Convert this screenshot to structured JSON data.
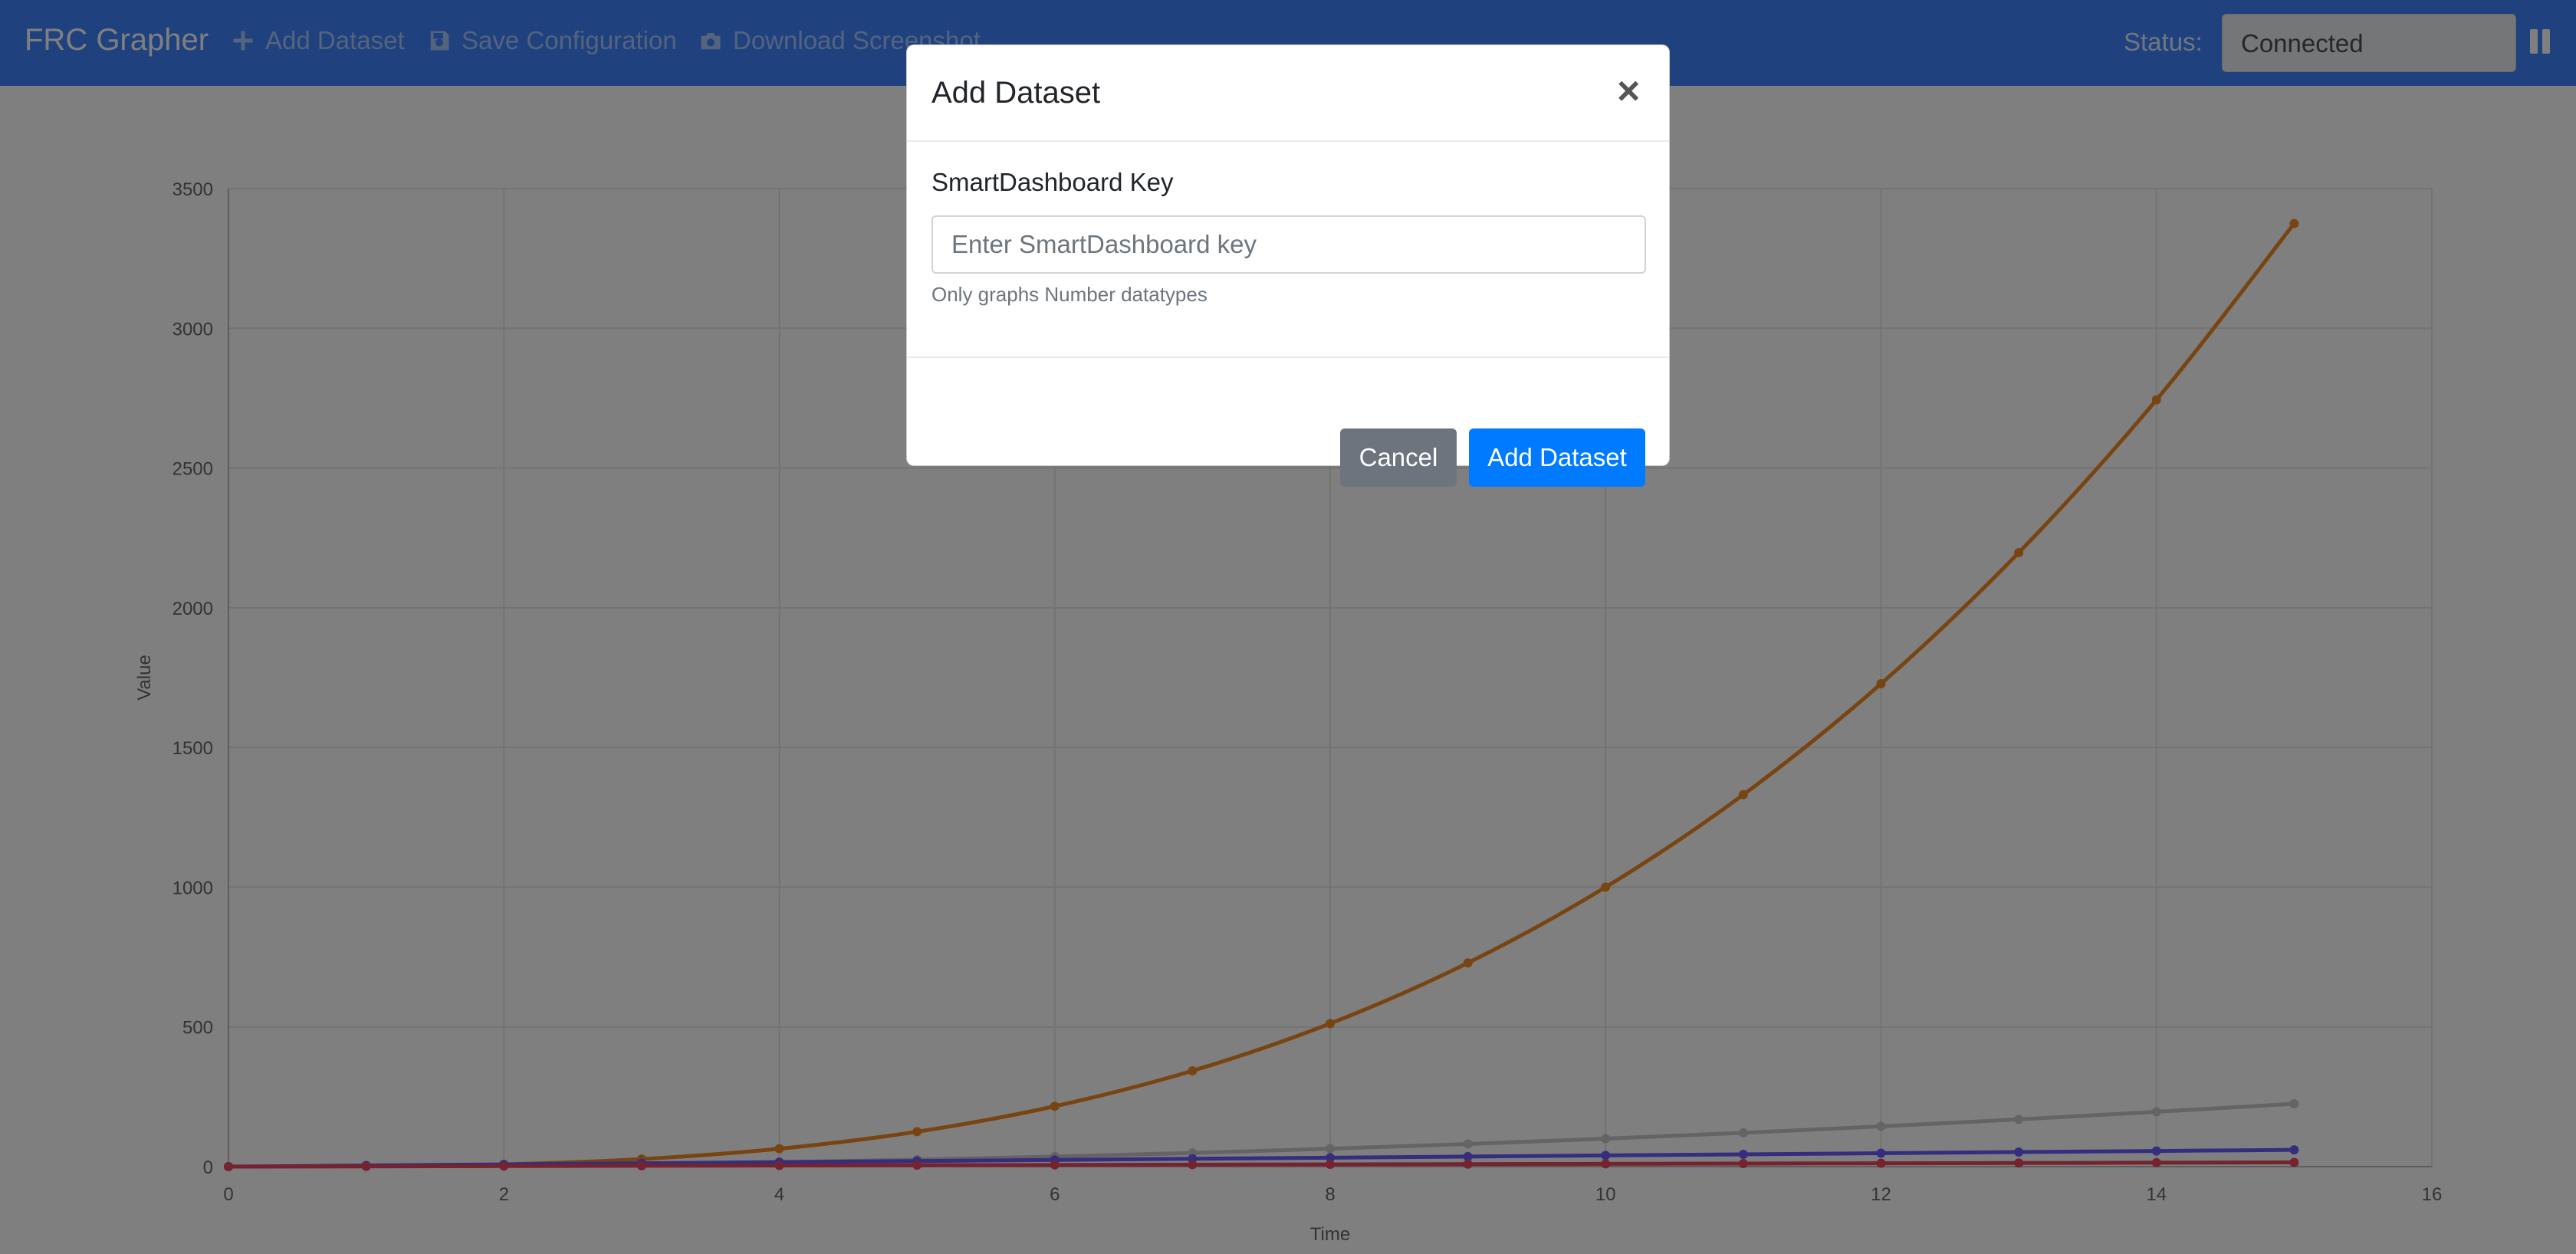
{
  "navbar": {
    "brand": "FRC Grapher",
    "actions": [
      {
        "label": "Add Dataset",
        "icon": "plus-icon"
      },
      {
        "label": "Save Configuration",
        "icon": "save-icon"
      },
      {
        "label": "Download Screenshot",
        "icon": "camera-icon"
      }
    ],
    "status_label": "Status:",
    "status_value": "Connected",
    "pause_icon": "pause-icon"
  },
  "modal": {
    "title": "Add Dataset",
    "close_icon": "close-icon",
    "field_label": "SmartDashboard Key",
    "input_placeholder": "Enter SmartDashboard key",
    "input_value": "",
    "help_text": "Only graphs Number datatypes",
    "cancel_label": "Cancel",
    "submit_label": "Add Dataset"
  },
  "colors": {
    "navbar": "#3f82fc",
    "primary_button": "#007bff",
    "secondary_button": "#6c757d"
  },
  "chart_data": {
    "type": "line",
    "title": "",
    "xlabel": "Time",
    "ylabel": "Value",
    "xlim": [
      0,
      16
    ],
    "ylim": [
      0,
      3500
    ],
    "xticks": [
      0,
      2,
      4,
      6,
      8,
      10,
      12,
      14,
      16
    ],
    "yticks": [
      0,
      500,
      1000,
      1500,
      2000,
      2500,
      3000,
      3500
    ],
    "grid": true,
    "x": [
      0,
      1,
      2,
      3,
      4,
      5,
      6,
      7,
      8,
      9,
      10,
      11,
      12,
      13,
      14,
      15
    ],
    "series": [
      {
        "color": "#f08a24",
        "values": [
          0,
          1,
          8,
          27,
          64,
          125,
          216,
          343,
          512,
          729,
          1000,
          1331,
          1728,
          2197,
          2744,
          3375
        ]
      },
      {
        "color": "#c8c8c8",
        "values": [
          0,
          1,
          4,
          9,
          16,
          25,
          36,
          49,
          64,
          81,
          100,
          121,
          144,
          169,
          196,
          225
        ]
      },
      {
        "color": "#6a5cff",
        "values": [
          0,
          4,
          8,
          12,
          16,
          20,
          24,
          28,
          32,
          36,
          40,
          44,
          48,
          52,
          56,
          60
        ]
      },
      {
        "color": "#e8475f",
        "values": [
          0,
          1,
          2,
          3,
          4,
          5,
          6,
          7,
          8,
          9,
          10,
          11,
          12,
          13,
          14,
          15
        ]
      }
    ]
  }
}
